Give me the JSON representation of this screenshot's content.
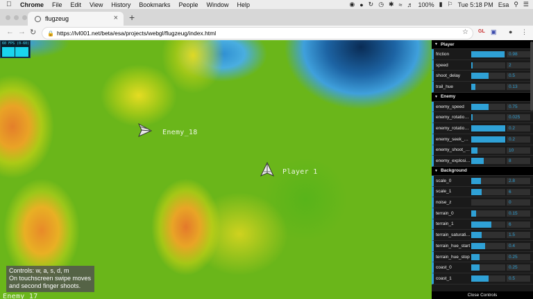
{
  "menubar": {
    "app": "Chrome",
    "items": [
      "File",
      "Edit",
      "View",
      "History",
      "Bookmarks",
      "People",
      "Window",
      "Help"
    ],
    "battery": "100%",
    "clock": "Tue 5:18 PM",
    "user": "Esa"
  },
  "tab": {
    "title": "flugzeug"
  },
  "address": {
    "url": "https://lvl001.net/beta/esa/projects/webgl/flugzeug/index.html"
  },
  "extensions": {
    "gl": "GL"
  },
  "game": {
    "fps_label": "60 FPS (0-60)",
    "enemy_label": "Enemy_18",
    "player_label": "Player 1",
    "bottom_label": "Enemy_17",
    "controls": [
      "Controls: w, a, s, d, m",
      "On touchscreen swipe moves",
      "and second finger shoots."
    ]
  },
  "gui": {
    "folders": [
      {
        "title": "Player",
        "rows": [
          {
            "label": "friction",
            "value": "0.98",
            "fraction": 0.98
          },
          {
            "label": "speed",
            "value": "2",
            "fraction": 0.04
          },
          {
            "label": "shoot_delay",
            "value": "0.5",
            "fraction": 0.5
          },
          {
            "label": "trail_hue",
            "value": "0.13",
            "fraction": 0.13
          }
        ]
      },
      {
        "title": "Enemy",
        "rows": [
          {
            "label": "enemy_speed",
            "value": "0.75",
            "fraction": 0.5
          },
          {
            "label": "enemy_rotation_speed",
            "value": "0.025",
            "fraction": 0.05
          },
          {
            "label": "enemy_rotation_damping",
            "value": "0.2",
            "fraction": 1.0
          },
          {
            "label": "enemy_seek_speed",
            "value": "0.2",
            "fraction": 1.0
          },
          {
            "label": "enemy_shoot_delay",
            "value": "10",
            "fraction": 0.18
          },
          {
            "label": "enemy_explosion",
            "value": "8",
            "fraction": 0.37
          }
        ]
      },
      {
        "title": "Background",
        "rows": [
          {
            "label": "scale_0",
            "value": "2.8",
            "fraction": 0.28
          },
          {
            "label": "scale_1",
            "value": "6",
            "fraction": 0.3
          },
          {
            "label": "noise_z",
            "value": "0",
            "fraction": 0.0
          },
          {
            "label": "terrain_0",
            "value": "0.15",
            "fraction": 0.15
          },
          {
            "label": "terrain_1",
            "value": "6",
            "fraction": 0.6
          },
          {
            "label": "terrain_saturation",
            "value": "1.5",
            "fraction": 0.3
          },
          {
            "label": "terrain_hue_start",
            "value": "0.4",
            "fraction": 0.4
          },
          {
            "label": "terrain_hue_stop",
            "value": "0.25",
            "fraction": 0.25
          },
          {
            "label": "coast_0",
            "value": "0.25",
            "fraction": 0.25
          },
          {
            "label": "coast_1",
            "value": "0.5",
            "fraction": 0.5
          }
        ]
      }
    ],
    "close_label": "Close Controls"
  }
}
